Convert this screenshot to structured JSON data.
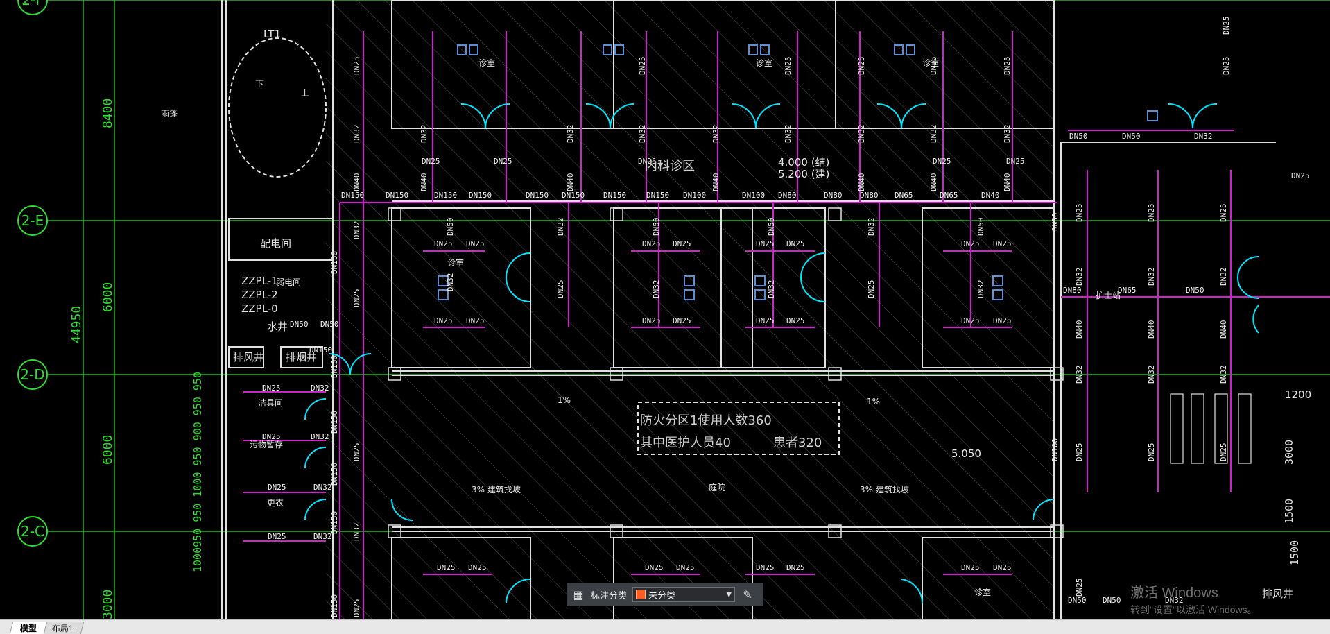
{
  "colors": {
    "grid": "#2ee02e",
    "pipe": "#d020d0",
    "wall": "#e0e0e0",
    "door": "#00e5ff",
    "hatch": "#bfbfbf",
    "fixture": "#5a8fd8"
  },
  "axes": {
    "rows": [
      "2-F",
      "2-E",
      "2-D",
      "2-C"
    ]
  },
  "dimensions": {
    "d1": "8400",
    "d2": "6000",
    "d3": "6000",
    "total": "44950",
    "d4": "3000",
    "right1": "1200",
    "right2": "3000",
    "right3": "1500",
    "right4": "1500",
    "seq": "1000950 950 1000 950 900 950 950"
  },
  "rooms": {
    "rain_shelter": "雨蓬",
    "elevator": "LT1",
    "down": "下",
    "up": "上",
    "electric_room": "配电间",
    "zpl1": "ZZPL-1",
    "zpl2": "ZZPL-2",
    "zpl0": "ZZPL-0",
    "weak_current": "弱电间",
    "water_shaft": "水井",
    "exhaust_shaft": "排风井",
    "smoke_shaft": "排烟井",
    "clean_room": "洁具间",
    "dirty_room": "污物暂存",
    "changing": "更衣",
    "exam_area": "内科诊区",
    "elev1": "4.000 (结)",
    "elev2": "5.200 (建)",
    "fire_zone": "防火分区1使用人数360",
    "staff": "其中医护人员40",
    "patients": "患者320",
    "elev3": "5.050",
    "slope1": "1%",
    "slope2": "1%",
    "slope3": "3% 建筑找坡",
    "slope4": "3% 建筑找坡",
    "courtyard": "庭院",
    "clinic": "诊室",
    "nurse": "护士站",
    "shaft_right": "排风井"
  },
  "pipes": {
    "dn25": "DN25",
    "dn32": "DN32",
    "dn40": "DN40",
    "dn50": "DN50",
    "dn65": "DN65",
    "dn80": "DN80",
    "dn100": "DN100",
    "dn150": "DN150"
  },
  "toolbar": {
    "label": "标注分类",
    "selected": "未分类",
    "swatch": "#ff5a1f",
    "grid_icon": "grid-icon",
    "edit_icon": "edit-icon"
  },
  "tabs": [
    {
      "label": "模型",
      "active": true
    },
    {
      "label": "布局1",
      "active": false
    }
  ],
  "watermark": {
    "line1": "激活 Windows",
    "line2": "转到\"设置\"以激活 Windows。"
  }
}
